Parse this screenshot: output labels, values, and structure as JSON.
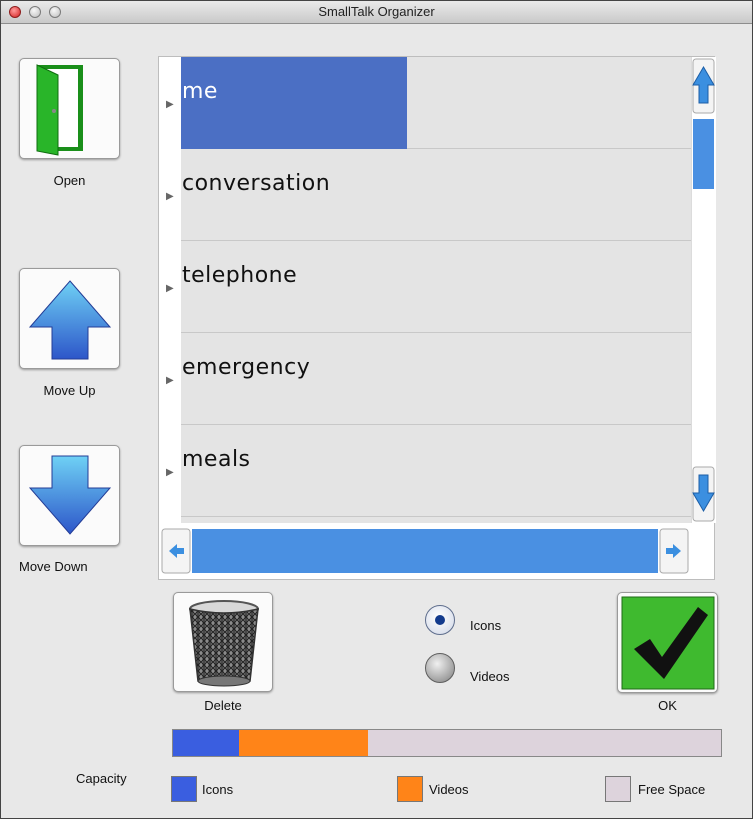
{
  "window": {
    "title": "SmallTalk Organizer"
  },
  "sidebar": {
    "open_label": "Open",
    "move_up_label": "Move Up",
    "move_down_label": "Move Down"
  },
  "list": {
    "items": [
      {
        "label": "me",
        "selected": true
      },
      {
        "label": "conversation",
        "selected": false
      },
      {
        "label": "telephone",
        "selected": false
      },
      {
        "label": "emergency",
        "selected": false
      },
      {
        "label": "meals",
        "selected": false
      }
    ]
  },
  "actions": {
    "delete_label": "Delete",
    "ok_label": "OK"
  },
  "view_mode": {
    "options": [
      "Icons",
      "Videos"
    ],
    "selected": "Icons"
  },
  "capacity": {
    "label": "Capacity",
    "icons_fraction": 0.12,
    "videos_fraction": 0.235,
    "free_fraction": 0.645,
    "legend": {
      "icons": "Icons",
      "videos": "Videos",
      "free": "Free Space"
    }
  },
  "colors": {
    "icons": "#3a5ee0",
    "videos": "#ff8418",
    "free": "#ddd3dc",
    "selection": "#4b6fc4",
    "scroll_accent": "#4a90e2",
    "ok_green": "#3fba2f"
  },
  "icons": {
    "open": "open-door-icon",
    "move_up": "up-arrow-icon",
    "move_down": "down-arrow-icon",
    "delete": "trash-can-icon",
    "ok": "checkmark-icon"
  }
}
